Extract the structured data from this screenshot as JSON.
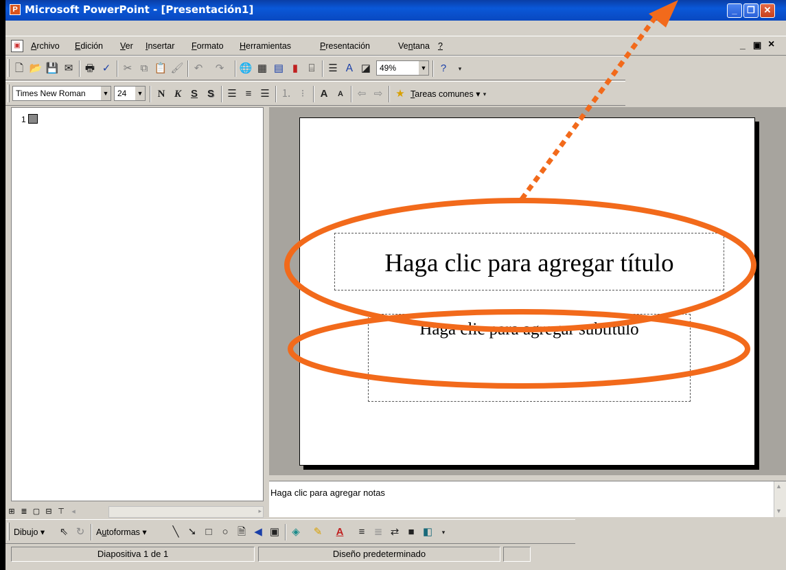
{
  "window": {
    "title": "Microsoft PowerPoint - [Presentación1]",
    "app_icon_glyph": "P"
  },
  "caption_buttons": {
    "minimize": "_",
    "maximize": "❐",
    "close": "✕"
  },
  "menu": {
    "items": [
      {
        "pre": "",
        "acc": "A",
        "post": "rchivo"
      },
      {
        "pre": "",
        "acc": "E",
        "post": "dición"
      },
      {
        "pre": "",
        "acc": "V",
        "post": "er"
      },
      {
        "pre": "",
        "acc": "I",
        "post": "nsertar"
      },
      {
        "pre": "",
        "acc": "F",
        "post": "ormato"
      },
      {
        "pre": "",
        "acc": "H",
        "post": "erramientas"
      },
      {
        "pre": "",
        "acc": "P",
        "post": "resentación"
      },
      {
        "pre": "Ve",
        "acc": "n",
        "post": "tana"
      },
      {
        "pre": "",
        "acc": "?",
        "post": ""
      }
    ],
    "doc_controls": {
      "minimize": "_",
      "restore": "ᗜ",
      "close": "×"
    }
  },
  "standard_toolbar": {
    "zoom": "49%",
    "icons": [
      "new-icon",
      "open-icon",
      "save-icon",
      "email-icon",
      "print-icon",
      "spelling-icon",
      "cut-icon",
      "copy-icon",
      "paste-icon",
      "format-painter-icon",
      "undo-icon",
      "redo-icon",
      "hyperlink-icon",
      "tables-borders-icon",
      "insert-table-icon",
      "insert-chart-icon",
      "new-slide-icon",
      "expand-icon",
      "grayscale-icon",
      "help-icon"
    ]
  },
  "formatting_toolbar": {
    "font": "Times New Roman",
    "size": "24",
    "bold": "N",
    "italic": "K",
    "underline": "S",
    "shadow": "S",
    "common_tasks_acc": "T",
    "common_tasks_rest": "areas comunes"
  },
  "outline": {
    "slide_number": "1"
  },
  "slide": {
    "title_placeholder": "Haga clic para agregar título",
    "subtitle_placeholder": "Haga clic para agregar subtítulo"
  },
  "notes": {
    "placeholder": "Haga clic para agregar notas"
  },
  "drawing_toolbar": {
    "draw_label": "Dibujo",
    "autoshapes_pre": "A",
    "autoshapes_acc": "u",
    "autoshapes_post": "toformas"
  },
  "status": {
    "slide_info": "Diapositiva 1 de 1",
    "design": "Diseño predeterminado"
  },
  "annotations": {
    "color": "#f26a1b"
  }
}
